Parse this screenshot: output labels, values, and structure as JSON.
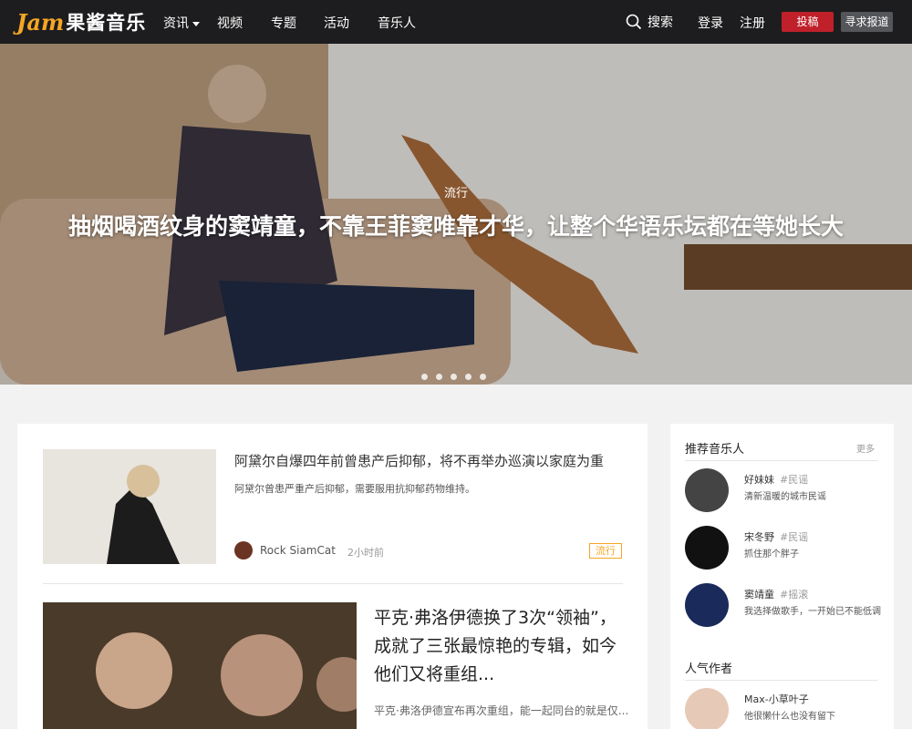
{
  "nav": {
    "logo_en": "Jam",
    "logo_cn": "果酱音乐",
    "items": [
      "资讯",
      "视频",
      "专题",
      "活动",
      "音乐人"
    ],
    "search": "搜索",
    "login": "登录",
    "register": "注册",
    "submit": "投稿",
    "report": "寻求报道"
  },
  "hero": {
    "category": "流行",
    "title": "抽烟喝酒纹身的窦靖童，不靠王菲窦唯靠才华，让整个华语乐坛都在等她长大",
    "slides": 5
  },
  "articles": [
    {
      "title": "阿黛尔自爆四年前曾患产后抑郁，将不再举办巡演以家庭为重",
      "desc": "阿黛尔曾患严重产后抑郁，需要服用抗抑郁药物维持。",
      "author": "Rock SiamCat",
      "time": "2小时前",
      "tag": "流行"
    },
    {
      "title": "平克·弗洛伊德换了3次“领袖”，成就了三张最惊艳的专辑，如今他们又将重组...",
      "desc": "平克·弗洛伊德宣布再次重组，能一起同台的就是仅..."
    }
  ],
  "sidebar": {
    "musicians_title": "推荐音乐人",
    "more": "更多",
    "musicians": [
      {
        "name": "好妹妹",
        "genre": "#民谣",
        "desc": "清新温暖的城市民谣"
      },
      {
        "name": "宋冬野",
        "genre": "#民谣",
        "desc": "抓住那个胖子"
      },
      {
        "name": "窦靖童",
        "genre": "#摇滚",
        "desc": "我选择做歌手，一开始已不能低调"
      }
    ],
    "authors_title": "人气作者",
    "authors": [
      {
        "name": "Max-小草叶子",
        "desc": "他很懒什么也没有留下"
      }
    ]
  },
  "colors": {
    "brand": "#f6a623",
    "nav_bg": "#1d1d1f",
    "submit": "#c0202a"
  }
}
